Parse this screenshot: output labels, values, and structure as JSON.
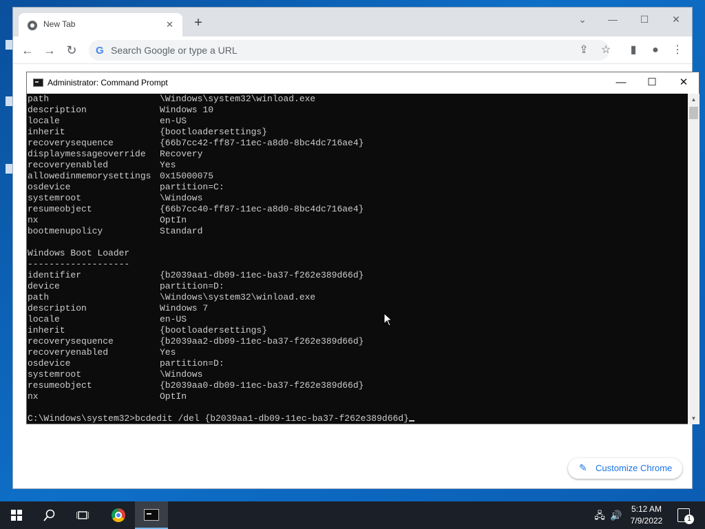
{
  "chrome": {
    "tab_title": "New Tab",
    "omnibox_placeholder": "Search Google or type a URL",
    "customize_label": "Customize Chrome"
  },
  "cmd": {
    "title": "Administrator: Command Prompt",
    "lines": [
      {
        "key": "path",
        "value": "\\Windows\\system32\\winload.exe"
      },
      {
        "key": "description",
        "value": "Windows 10"
      },
      {
        "key": "locale",
        "value": "en-US"
      },
      {
        "key": "inherit",
        "value": "{bootloadersettings}"
      },
      {
        "key": "recoverysequence",
        "value": "{66b7cc42-ff87-11ec-a8d0-8bc4dc716ae4}"
      },
      {
        "key": "displaymessageoverride",
        "value": "Recovery"
      },
      {
        "key": "recoveryenabled",
        "value": "Yes"
      },
      {
        "key": "allowedinmemorysettings",
        "value": "0x15000075"
      },
      {
        "key": "osdevice",
        "value": "partition=C:"
      },
      {
        "key": "systemroot",
        "value": "\\Windows"
      },
      {
        "key": "resumeobject",
        "value": "{66b7cc40-ff87-11ec-a8d0-8bc4dc716ae4}"
      },
      {
        "key": "nx",
        "value": "OptIn"
      },
      {
        "key": "bootmenupolicy",
        "value": "Standard"
      },
      {
        "key": "",
        "value": ""
      },
      {
        "key": "Windows Boot Loader",
        "value": ""
      },
      {
        "key": "-------------------",
        "value": ""
      },
      {
        "key": "identifier",
        "value": "{b2039aa1-db09-11ec-ba37-f262e389d66d}"
      },
      {
        "key": "device",
        "value": "partition=D:"
      },
      {
        "key": "path",
        "value": "\\Windows\\system32\\winload.exe"
      },
      {
        "key": "description",
        "value": "Windows 7"
      },
      {
        "key": "locale",
        "value": "en-US"
      },
      {
        "key": "inherit",
        "value": "{bootloadersettings}"
      },
      {
        "key": "recoverysequence",
        "value": "{b2039aa2-db09-11ec-ba37-f262e389d66d}"
      },
      {
        "key": "recoveryenabled",
        "value": "Yes"
      },
      {
        "key": "osdevice",
        "value": "partition=D:"
      },
      {
        "key": "systemroot",
        "value": "\\Windows"
      },
      {
        "key": "resumeobject",
        "value": "{b2039aa0-db09-11ec-ba37-f262e389d66d}"
      },
      {
        "key": "nx",
        "value": "OptIn"
      },
      {
        "key": "",
        "value": ""
      }
    ],
    "prompt": "C:\\Windows\\system32>",
    "command": "bcdedit /del {b2039aa1-db09-11ec-ba37-f262e389d66d}"
  },
  "taskbar": {
    "time": "5:12 AM",
    "date": "7/9/2022",
    "notification_count": "1"
  },
  "icons": {
    "browser": "chrome-icon",
    "terminal": "command-prompt-icon",
    "start": "windows-start-icon",
    "search": "search-icon",
    "task_view": "task-view-icon"
  },
  "colors": {
    "console_bg": "#0c0c0c",
    "console_fg": "#cccccc",
    "accent": "#1a73e8"
  }
}
